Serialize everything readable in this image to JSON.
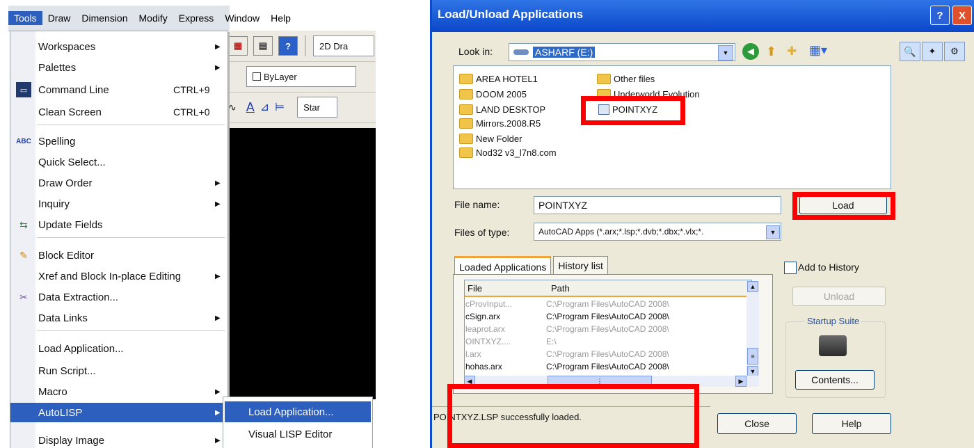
{
  "menubar": {
    "items": [
      "Tools",
      "Draw",
      "Dimension",
      "Modify",
      "Express",
      "Window",
      "Help"
    ]
  },
  "toolbar": {
    "workspace_combo": "2D Dra",
    "layer_combo": "ByLayer",
    "style_combo": "Star"
  },
  "tools_menu": {
    "items": [
      {
        "label": "Workspaces",
        "shortcut": "",
        "submenu": true
      },
      {
        "label": "Palettes",
        "shortcut": "",
        "submenu": true
      },
      {
        "label": "Command Line",
        "shortcut": "CTRL+9",
        "submenu": false
      },
      {
        "label": "Clean Screen",
        "shortcut": "CTRL+0",
        "submenu": false
      },
      {
        "label": "Spelling",
        "shortcut": "",
        "submenu": false
      },
      {
        "label": "Quick Select...",
        "shortcut": "",
        "submenu": false
      },
      {
        "label": "Draw Order",
        "shortcut": "",
        "submenu": true
      },
      {
        "label": "Inquiry",
        "shortcut": "",
        "submenu": true
      },
      {
        "label": "Update Fields",
        "shortcut": "",
        "submenu": false
      },
      {
        "label": "Block Editor",
        "shortcut": "",
        "submenu": false
      },
      {
        "label": "Xref and Block In-place Editing",
        "shortcut": "",
        "submenu": true
      },
      {
        "label": "Data Extraction...",
        "shortcut": "",
        "submenu": false
      },
      {
        "label": "Data Links",
        "shortcut": "",
        "submenu": true
      },
      {
        "label": "Load Application...",
        "shortcut": "",
        "submenu": false
      },
      {
        "label": "Run Script...",
        "shortcut": "",
        "submenu": false
      },
      {
        "label": "Macro",
        "shortcut": "",
        "submenu": true
      },
      {
        "label": "AutoLISP",
        "shortcut": "",
        "submenu": true
      },
      {
        "label": "Display Image",
        "shortcut": "",
        "submenu": true
      }
    ]
  },
  "autolisp_submenu": {
    "items": [
      "Load Application...",
      "Visual LISP Editor"
    ]
  },
  "dialog": {
    "title": "Load/Unload Applications",
    "help_button": "?",
    "close_button": "X",
    "look_in_label": "Look in:",
    "look_in_value": "ASHARF (E:)",
    "folders_col1": [
      "AREA HOTEL1",
      "DOOM 2005",
      "LAND DESKTOP",
      "Mirrors.2008.R5",
      "New Folder",
      "Nod32 v3_l7n8.com"
    ],
    "folders_col2": [
      "Other files",
      "Underworld Evolution"
    ],
    "file_item": "POINTXYZ",
    "file_name_label": "File name:",
    "file_name_value": "POINTXYZ",
    "files_of_type_label": "Files of type:",
    "files_of_type_value": "AutoCAD Apps (*.arx;*.lsp;*.dvb;*.dbx;*.vlx;*.",
    "load_button": "Load",
    "tab_loaded": "Loaded Applications",
    "tab_history": "History list",
    "add_to_history": "Add to History",
    "unload_button": "Unload",
    "startup_suite_label": "Startup Suite",
    "contents_button": "Contents...",
    "grid_headers": [
      "File",
      "Path"
    ],
    "grid_rows": [
      {
        "file": "cProvInput...",
        "path": "C:\\Program Files\\AutoCAD 2008\\",
        "dim": true
      },
      {
        "file": "cSign.arx",
        "path": "C:\\Program Files\\AutoCAD 2008\\",
        "dim": false
      },
      {
        "file": "leaprot.arx",
        "path": "C:\\Program Files\\AutoCAD 2008\\",
        "dim": true
      },
      {
        "file": "OINTXYZ....",
        "path": "E:\\",
        "dim": true
      },
      {
        "file": "l.arx",
        "path": "C:\\Program Files\\AutoCAD 2008\\",
        "dim": true
      },
      {
        "file": "hohas.arx",
        "path": "C:\\Program Files\\AutoCAD 2008\\",
        "dim": false
      }
    ],
    "status_message": "POINTXYZ.LSP successfully loaded.",
    "close_dialog_button": "Close",
    "help_dialog_button": "Help"
  }
}
